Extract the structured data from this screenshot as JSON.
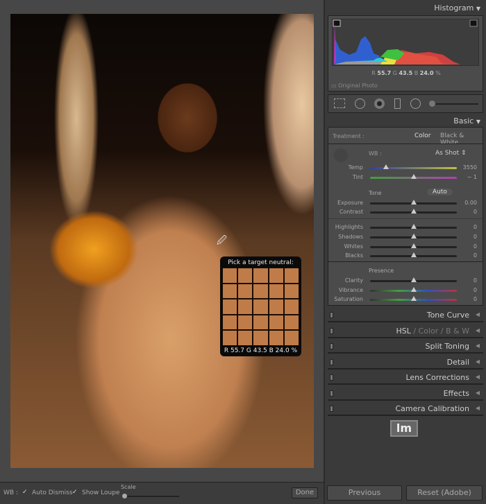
{
  "loupe": {
    "title": "Pick a target neutral:",
    "r": "55.7",
    "g": "43.5",
    "b": "24.0",
    "unit": "%"
  },
  "bottombar": {
    "wb_label": "WB :",
    "auto_dismiss": "Auto Dismiss",
    "show_loupe": "Show Loupe",
    "scale": "Scale",
    "done": "Done"
  },
  "histogram": {
    "title": "Histogram",
    "r_label": "R",
    "r": "55.7",
    "g_label": "G",
    "g": "43.5",
    "b_label": "B",
    "b": "24.0",
    "unit": "%",
    "original_photo": "Original Photo"
  },
  "basic": {
    "title": "Basic",
    "treatment": "Treatment :",
    "color": "Color",
    "bw": "Black & White",
    "wb": "WB :",
    "wb_value": "As Shot",
    "tone": "Tone",
    "auto": "Auto",
    "presence": "Presence",
    "sliders": [
      {
        "label": "Temp",
        "value": "3550",
        "pos": 0.18
      },
      {
        "label": "Tint",
        "value": "− 1",
        "pos": 0.5
      },
      {
        "label": "Exposure",
        "value": "0.00",
        "pos": 0.5
      },
      {
        "label": "Contrast",
        "value": "0",
        "pos": 0.5
      },
      {
        "label": "Highlights",
        "value": "0",
        "pos": 0.5
      },
      {
        "label": "Shadows",
        "value": "0",
        "pos": 0.5
      },
      {
        "label": "Whites",
        "value": "0",
        "pos": 0.5
      },
      {
        "label": "Blacks",
        "value": "0",
        "pos": 0.5
      },
      {
        "label": "Clarity",
        "value": "0",
        "pos": 0.5
      },
      {
        "label": "Vibrance",
        "value": "0",
        "pos": 0.5
      },
      {
        "label": "Saturation",
        "value": "0",
        "pos": 0.5
      }
    ]
  },
  "panels": [
    "Tone Curve",
    "HSL",
    "Split Toning",
    "Detail",
    "Lens Corrections",
    "Effects",
    "Camera Calibration"
  ],
  "hsl": {
    "color": "Color",
    "bw": "B & W",
    "sep": "/"
  },
  "logo": "lm",
  "buttons": {
    "previous": "Previous",
    "reset": "Reset (Adobe)"
  }
}
